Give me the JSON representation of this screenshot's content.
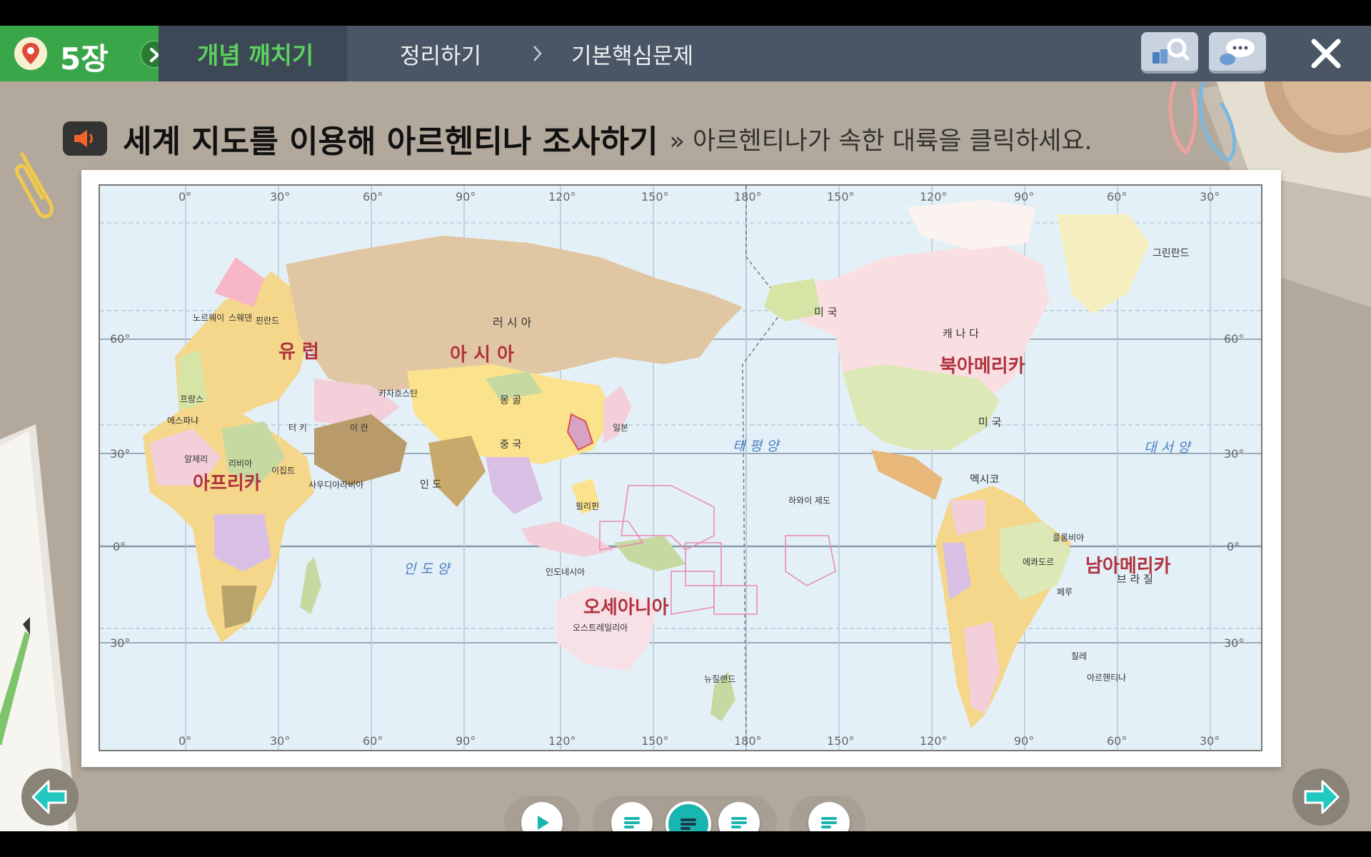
{
  "nav": {
    "chapter": "5장",
    "steps": [
      {
        "label": "개념 깨치기"
      },
      {
        "label": "정리하기"
      },
      {
        "label": "기본핵심문제"
      }
    ]
  },
  "content": {
    "title": "세계 지도를 이용해 아르헨티나 조사하기",
    "instruction": "» 아르헨티나가 속한 대륙을 클릭하세요."
  },
  "map": {
    "longitudes": [
      "0°",
      "30°",
      "60°",
      "90°",
      "120°",
      "150°",
      "180°",
      "150°",
      "120°",
      "90°",
      "60°",
      "30°"
    ],
    "latitudes_left": [
      "60°",
      "30°",
      "0°",
      "30°"
    ],
    "latitudes_right": [
      "60°",
      "30°",
      "0°",
      "30°"
    ],
    "continents": {
      "europe": "유 럽",
      "asia": "아 시 아",
      "africa": "아프리카",
      "oceania": "오세아니아",
      "north_america": "북아메리카",
      "south_america": "남아메리카"
    },
    "oceans": {
      "pacific": "태 평 양",
      "indian": "인 도 양",
      "atlantic": "대 서 양"
    },
    "countries": {
      "russia": "러 시 아",
      "mongolia": "몽 골",
      "china": "중 국",
      "india": "인 도",
      "kazakhstan": "카자흐스탄",
      "usa_alaska": "미 국",
      "canada": "캐 나 다",
      "usa": "미 국",
      "mexico": "멕시코",
      "brazil": "브 라 질",
      "argentina": "아르헨티나",
      "greenland": "그린란드",
      "australia": "오스트레일리아",
      "new_zealand": "뉴질랜드",
      "hawaii": "하와이 제도",
      "peru": "페루",
      "chile": "칠레",
      "ecuador": "에콰도르",
      "colombia": "콜롬비아",
      "indonesia": "인도네시아",
      "philippines": "필리핀",
      "turkey": "터 키",
      "iran": "이 란",
      "saudi": "사우디아라비아",
      "egypt": "이집트",
      "libya": "리비아",
      "algeria": "알제리",
      "france": "프랑스",
      "spain": "에스파냐",
      "japan": "일본",
      "norway": "노르웨이",
      "sweden": "스웨덴",
      "finland": "핀란드"
    }
  }
}
